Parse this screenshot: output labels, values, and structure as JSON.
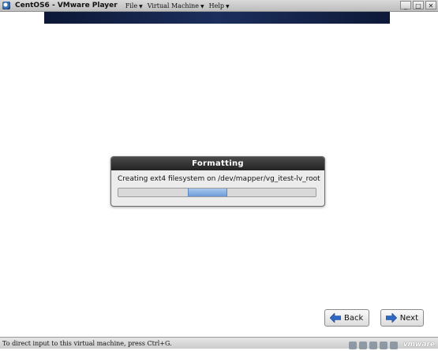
{
  "window": {
    "title": "CentOS6 - VMware Player",
    "menu": [
      {
        "label": "File"
      },
      {
        "label": "Virtual Machine"
      },
      {
        "label": "Help"
      }
    ],
    "controls": {
      "minimize": "_",
      "maximize": "□",
      "close": "✕"
    }
  },
  "dialog": {
    "title": "Formatting",
    "message": "Creating ext4 filesystem on /dev/mapper/vg_itest-lv_root",
    "progress": {
      "state": "indeterminate",
      "pulse_position": 0.45
    }
  },
  "buttons": {
    "back_label": "Back",
    "next_label": "Next"
  },
  "statusbar": {
    "hint": "To direct input to this virtual machine, press Ctrl+G.",
    "logo": "vmware"
  },
  "colors": {
    "banner": "#1b2e5c",
    "dialog_title_bg": "#2b2b2b",
    "progress_pulse": "#6d9bd8",
    "arrow_blue": "#2f68c4"
  }
}
